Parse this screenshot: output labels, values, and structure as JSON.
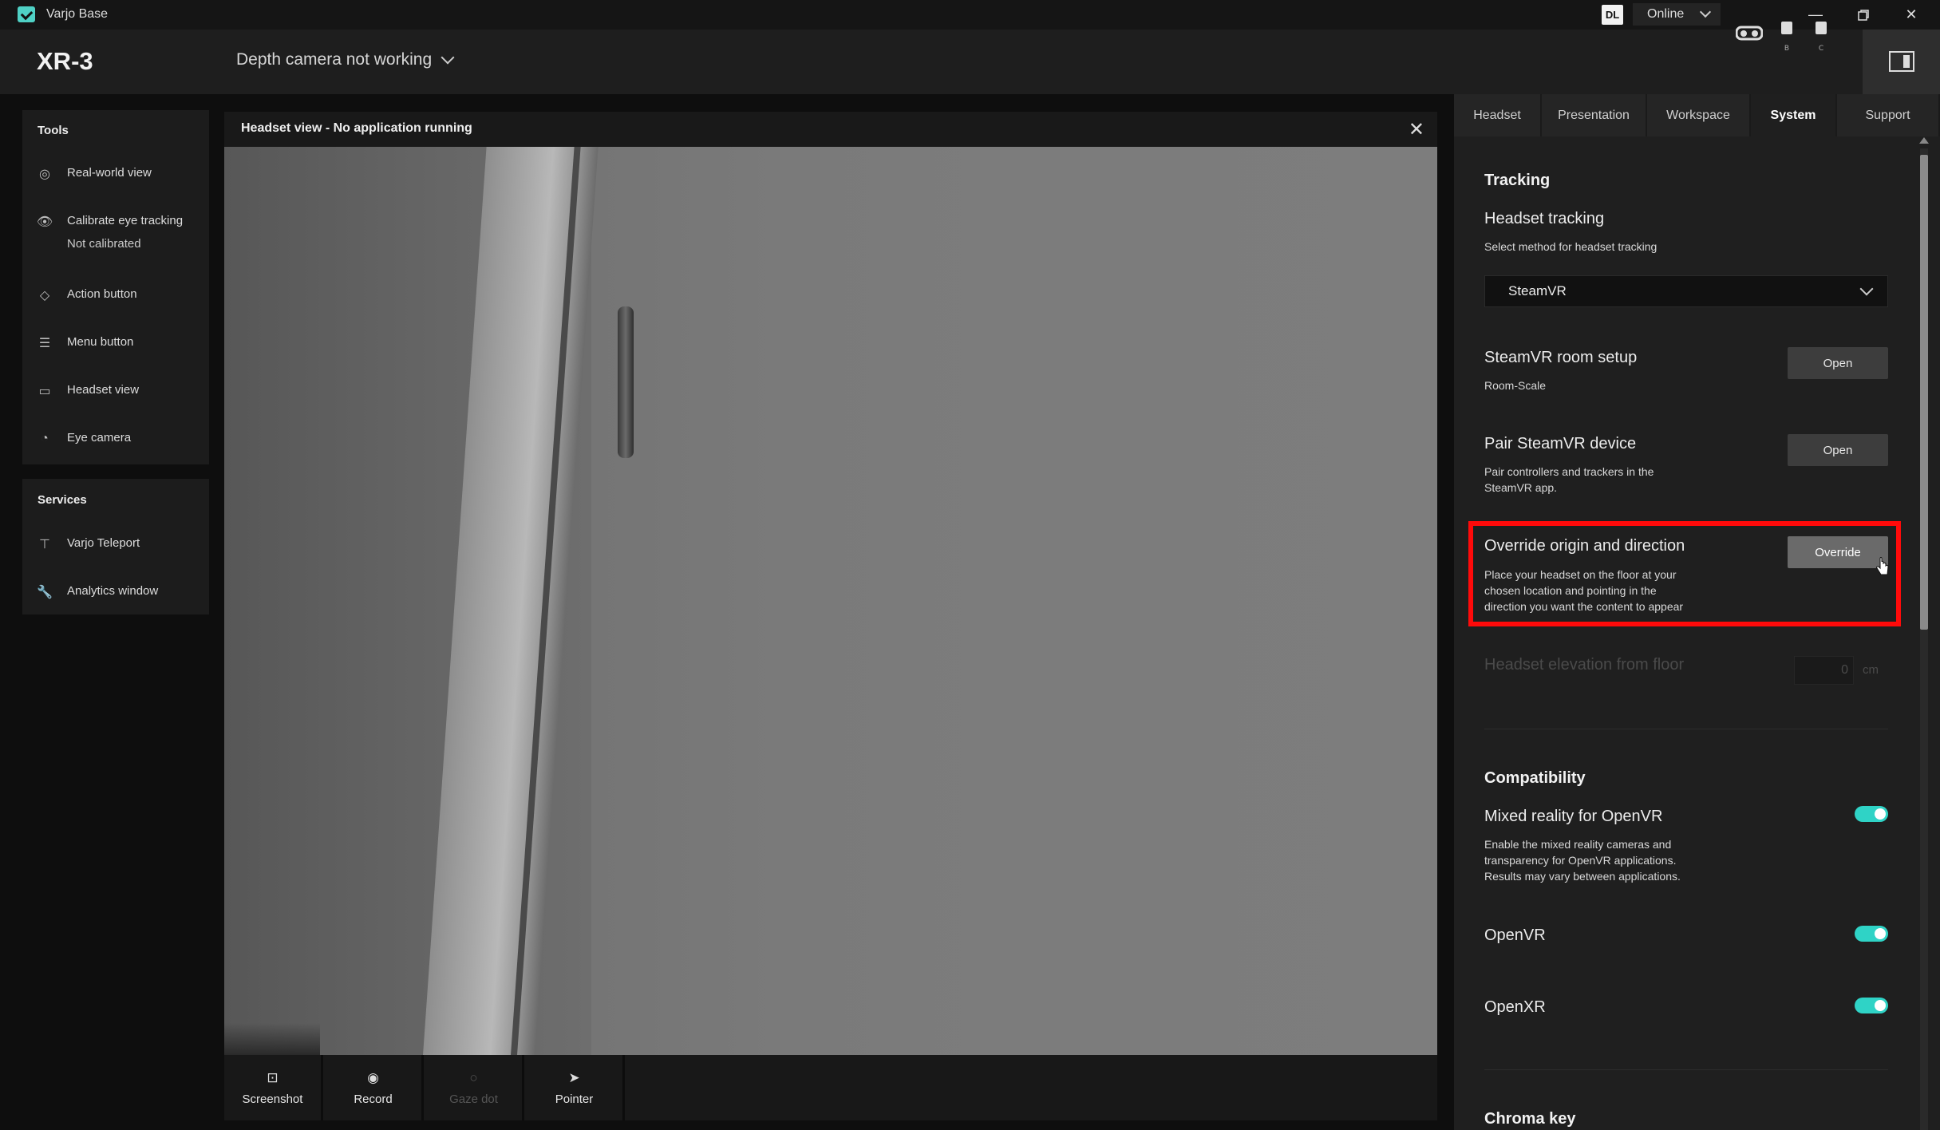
{
  "window": {
    "app_name": "Varjo Base",
    "user_badge": "DL",
    "status": "Online"
  },
  "header": {
    "device": "XR-3",
    "status_message": "Depth camera not working"
  },
  "sidebar": {
    "tools_title": "Tools",
    "tools": [
      {
        "label": "Real-world view"
      },
      {
        "label": "Calibrate eye tracking",
        "sub": "Not calibrated"
      },
      {
        "label": "Action button"
      },
      {
        "label": "Menu button"
      },
      {
        "label": "Headset view"
      },
      {
        "label": "Eye camera"
      }
    ],
    "services_title": "Services",
    "services": [
      {
        "label": "Varjo Teleport"
      },
      {
        "label": "Analytics window"
      }
    ]
  },
  "headset_view": {
    "title": "Headset view - No application running",
    "toolbar": [
      {
        "label": "Screenshot",
        "enabled": true
      },
      {
        "label": "Record",
        "enabled": true
      },
      {
        "label": "Gaze dot",
        "enabled": false
      },
      {
        "label": "Pointer",
        "enabled": true
      }
    ]
  },
  "tabs": [
    {
      "label": "Headset"
    },
    {
      "label": "Presentation"
    },
    {
      "label": "Workspace"
    },
    {
      "label": "System",
      "active": true
    },
    {
      "label": "Support"
    }
  ],
  "tracking": {
    "section_title": "Tracking",
    "headset_tracking": {
      "title": "Headset tracking",
      "desc": "Select method for headset tracking",
      "selected": "SteamVR"
    },
    "room_setup": {
      "title": "SteamVR room setup",
      "desc": "Room-Scale",
      "button": "Open"
    },
    "pair_device": {
      "title": "Pair SteamVR device",
      "desc_1": "Pair controllers and trackers in the",
      "desc_2": "SteamVR app.",
      "button": "Open"
    },
    "override": {
      "title": "Override origin and direction",
      "desc_1": "Place your headset on the floor at your",
      "desc_2": "chosen location and pointing in the",
      "desc_3": "direction you want the content to appear",
      "button": "Override"
    },
    "elevation": {
      "title": "Headset elevation from floor",
      "value": "0",
      "unit": "cm"
    }
  },
  "compatibility": {
    "section_title": "Compatibility",
    "mixed_reality": {
      "title": "Mixed reality for OpenVR",
      "desc_1": "Enable the mixed reality cameras and",
      "desc_2": "transparency for OpenVR applications.",
      "desc_3": "Results may vary between applications."
    },
    "openvr": {
      "title": "OpenVR"
    },
    "openxr": {
      "title": "OpenXR"
    }
  },
  "chroma_key": {
    "section_title": "Chroma key"
  },
  "colors": {
    "accent": "#2fd3c6",
    "highlight": "#ff0a0a"
  }
}
